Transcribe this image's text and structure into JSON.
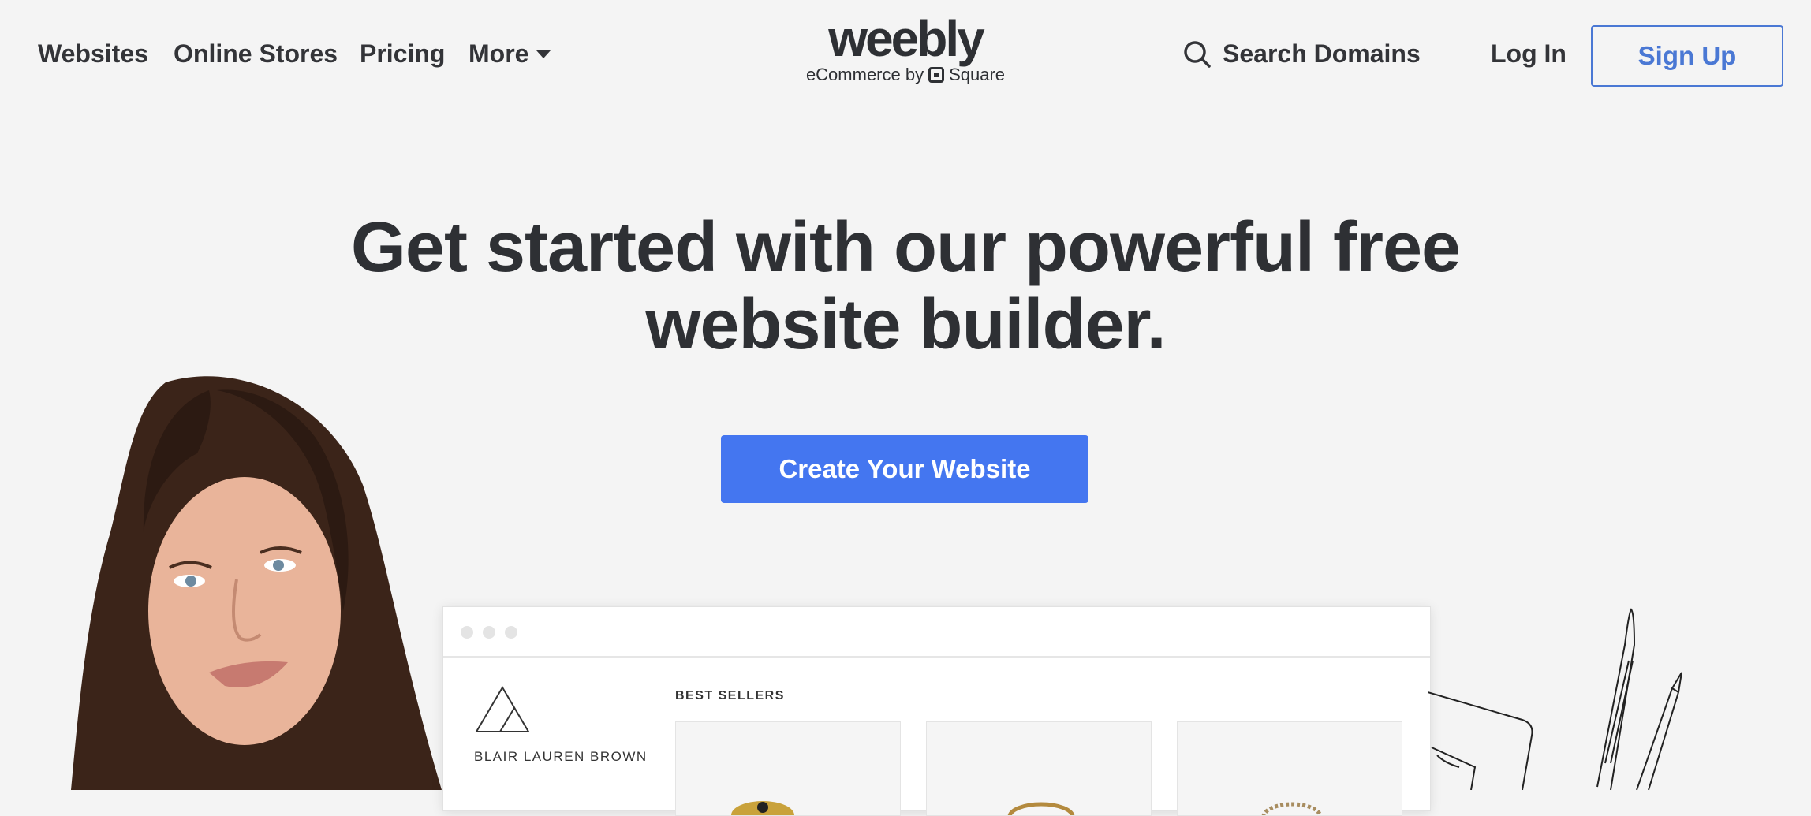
{
  "nav": {
    "websites": "Websites",
    "online_stores": "Online Stores",
    "pricing": "Pricing",
    "more": "More"
  },
  "logo": {
    "wordmark": "weebly",
    "tagline": "eCommerce by",
    "partner": "Square"
  },
  "header_right": {
    "search_domains": "Search Domains",
    "log_in": "Log In",
    "sign_up": "Sign Up"
  },
  "hero": {
    "headline_line1": "Get started with our powerful free",
    "headline_line2": "website builder.",
    "cta": "Create Your Website"
  },
  "preview": {
    "brand": "BLAIR LAUREN BROWN",
    "section": "BEST SELLERS"
  },
  "colors": {
    "background": "#f4f4f4",
    "text": "#2e3034",
    "accent": "#4476f0",
    "signup_border": "#4a78d4"
  }
}
